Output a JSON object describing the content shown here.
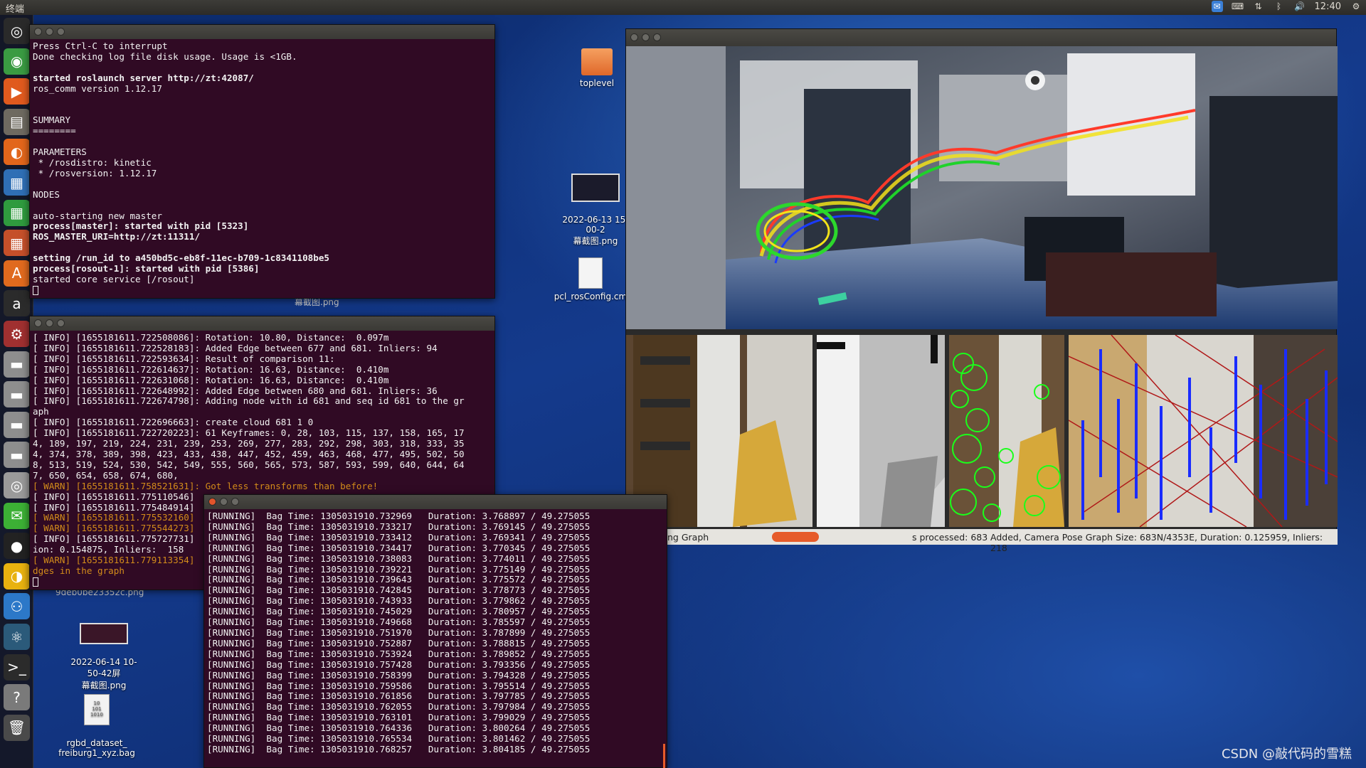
{
  "topbar": {
    "title": "终端",
    "time": "12:40"
  },
  "launcher": {
    "items": [
      {
        "name": "ubuntu-dash-icon",
        "glyph": "◎",
        "color": "#2a2a2a"
      },
      {
        "name": "chrome-icon",
        "glyph": "◉",
        "color": "#3a9b42"
      },
      {
        "name": "video-player-icon",
        "glyph": "▶",
        "color": "#e05a1e"
      },
      {
        "name": "files-icon",
        "glyph": "▤",
        "color": "#6e6a60"
      },
      {
        "name": "firefox-icon",
        "glyph": "◐",
        "color": "#e2661b"
      },
      {
        "name": "writer-icon",
        "glyph": "▦",
        "color": "#2f6fb5"
      },
      {
        "name": "calc-icon",
        "glyph": "▦",
        "color": "#2f9b3e"
      },
      {
        "name": "impress-icon",
        "glyph": "▦",
        "color": "#c5502a"
      },
      {
        "name": "software-center-icon",
        "glyph": "A",
        "color": "#e06a1e"
      },
      {
        "name": "amazon-icon",
        "glyph": "a",
        "color": "#2b2b2b"
      },
      {
        "name": "system-settings-icon",
        "glyph": "⚙",
        "color": "#a03030"
      },
      {
        "name": "drive-icon",
        "glyph": "▬",
        "color": "#8e8e8e"
      },
      {
        "name": "drive-icon",
        "glyph": "▬",
        "color": "#8e8e8e"
      },
      {
        "name": "drive-icon",
        "glyph": "▬",
        "color": "#8e8e8e"
      },
      {
        "name": "drive-icon",
        "glyph": "▬",
        "color": "#8e8e8e"
      },
      {
        "name": "disc-icon",
        "glyph": "◎",
        "color": "#9a9a9a"
      },
      {
        "name": "wechat-icon",
        "glyph": "✉",
        "color": "#3cb035"
      },
      {
        "name": "qq-icon",
        "glyph": "●",
        "color": "#222"
      },
      {
        "name": "app-icon",
        "glyph": "◑",
        "color": "#e8b20f"
      },
      {
        "name": "network-icon",
        "glyph": "⚇",
        "color": "#2c78c8"
      },
      {
        "name": "ros-icon",
        "glyph": "⚛",
        "color": "#2b5a7a"
      },
      {
        "name": "terminal-icon",
        "glyph": ">_",
        "color": "#2b2b2b"
      },
      {
        "name": "help-icon",
        "glyph": "?",
        "color": "#7a7a7a"
      },
      {
        "name": "trash-icon",
        "glyph": "🗑",
        "color": "#4a4a4a"
      }
    ]
  },
  "desktop": {
    "icons": [
      {
        "name": "desktop-folder-toplevel",
        "label": "toplevel"
      },
      {
        "name": "desktop-screenshot-0613",
        "label": "2022-06-13 15-00-2\n幕截图.png"
      },
      {
        "name": "desktop-pcl-config",
        "label": "pcl_rosConfig.cm"
      },
      {
        "name": "desktop-screenshot-0614",
        "label": "2022-06-14 10-50-42屏\n幕截图.png"
      },
      {
        "name": "desktop-bag-file",
        "label": "rgbd_dataset_\nfreiburg1_xyz.bag"
      }
    ],
    "hidden_labels": [
      "幕截图.png",
      "9deb0be23352c.png"
    ]
  },
  "term1": {
    "lines": [
      {
        "t": "Press Ctrl-C to interrupt"
      },
      {
        "t": "Done checking log file disk usage. Usage is <1GB."
      },
      {
        "t": ""
      },
      {
        "t": "started roslaunch server http://zt:42087/",
        "b": true
      },
      {
        "t": "ros_comm version 1.12.17"
      },
      {
        "t": ""
      },
      {
        "t": ""
      },
      {
        "t": "SUMMARY"
      },
      {
        "t": "========"
      },
      {
        "t": ""
      },
      {
        "t": "PARAMETERS"
      },
      {
        "t": " * /rosdistro: kinetic"
      },
      {
        "t": " * /rosversion: 1.12.17"
      },
      {
        "t": ""
      },
      {
        "t": "NODES"
      },
      {
        "t": ""
      },
      {
        "t": "auto-starting new master"
      },
      {
        "t": "process[master]: started with pid [5323]",
        "b": true
      },
      {
        "t": "ROS_MASTER_URI=http://zt:11311/",
        "b": true
      },
      {
        "t": ""
      },
      {
        "t": "setting /run_id to a450bd5c-eb8f-11ec-b709-1c8341108be5",
        "b": true
      },
      {
        "t": "process[rosout-1]: started with pid [5386]",
        "b": true
      },
      {
        "t": "started core service [/rosout]"
      }
    ]
  },
  "term2": {
    "lines": [
      {
        "t": "[ INFO] [1655181611.722508086]: Rotation: 10.80, Distance:  0.097m"
      },
      {
        "t": "[ INFO] [1655181611.722528183]: Added Edge between 677 and 681. Inliers: 94"
      },
      {
        "t": "[ INFO] [1655181611.722593634]: Result of comparison 11:"
      },
      {
        "t": "[ INFO] [1655181611.722614637]: Rotation: 16.63, Distance:  0.410m"
      },
      {
        "t": "[ INFO] [1655181611.722631068]: Rotation: 16.63, Distance:  0.410m"
      },
      {
        "t": "[ INFO] [1655181611.722648992]: Added Edge between 680 and 681. Inliers: 36"
      },
      {
        "t": "[ INFO] [1655181611.722674798]: Adding node with id 681 and seq id 681 to the gr"
      },
      {
        "t": "aph"
      },
      {
        "t": "[ INFO] [1655181611.722696663]: create cloud 681 1 0"
      },
      {
        "t": "[ INFO] [1655181611.722720223]: 61 Keyframes: 0, 28, 103, 115, 137, 158, 165, 17"
      },
      {
        "t": "4, 189, 197, 219, 224, 231, 239, 253, 269, 277, 283, 292, 298, 303, 318, 333, 35"
      },
      {
        "t": "4, 374, 378, 389, 398, 423, 433, 438, 447, 452, 459, 463, 468, 477, 495, 502, 50"
      },
      {
        "t": "8, 513, 519, 524, 530, 542, 549, 555, 560, 565, 573, 587, 593, 599, 640, 644, 64"
      },
      {
        "t": "7, 650, 654, 658, 674, 680,"
      },
      {
        "t": "[ WARN] [1655181611.758521631]: Got less transforms than before!",
        "w": true
      },
      {
        "t": "[ INFO] [1655181611.775110546]"
      },
      {
        "t": "[ INFO] [1655181611.775484914]"
      },
      {
        "t": "[ WARN] [1655181611.775532160]",
        "w": true
      },
      {
        "t": "[ WARN] [1655181611.775544273]",
        "w": true
      },
      {
        "t": "[ INFO] [1655181611.775727731]"
      },
      {
        "t": "ion: 0.154875, Inliers:  158"
      },
      {
        "t": "[ WARN] [1655181611.779113354]",
        "w": true
      },
      {
        "t": "dges in the graph",
        "w": true
      }
    ]
  },
  "term3": {
    "lines": [
      "[RUNNING]  Bag Time: 1305031910.732969   Duration: 3.768897 / 49.275055",
      "[RUNNING]  Bag Time: 1305031910.733217   Duration: 3.769145 / 49.275055",
      "[RUNNING]  Bag Time: 1305031910.733412   Duration: 3.769341 / 49.275055",
      "[RUNNING]  Bag Time: 1305031910.734417   Duration: 3.770345 / 49.275055",
      "[RUNNING]  Bag Time: 1305031910.738083   Duration: 3.774011 / 49.275055",
      "[RUNNING]  Bag Time: 1305031910.739221   Duration: 3.775149 / 49.275055",
      "[RUNNING]  Bag Time: 1305031910.739643   Duration: 3.775572 / 49.275055",
      "[RUNNING]  Bag Time: 1305031910.742845   Duration: 3.778773 / 49.275055",
      "[RUNNING]  Bag Time: 1305031910.743933   Duration: 3.779862 / 49.275055",
      "[RUNNING]  Bag Time: 1305031910.745029   Duration: 3.780957 / 49.275055",
      "[RUNNING]  Bag Time: 1305031910.749668   Duration: 3.785597 / 49.275055",
      "[RUNNING]  Bag Time: 1305031910.751970   Duration: 3.787899 / 49.275055",
      "[RUNNING]  Bag Time: 1305031910.752887   Duration: 3.788815 / 49.275055",
      "[RUNNING]  Bag Time: 1305031910.753924   Duration: 3.789852 / 49.275055",
      "[RUNNING]  Bag Time: 1305031910.757428   Duration: 3.793356 / 49.275055",
      "[RUNNING]  Bag Time: 1305031910.758399   Duration: 3.794328 / 49.275055",
      "[RUNNING]  Bag Time: 1305031910.759586   Duration: 3.795514 / 49.275055",
      "[RUNNING]  Bag Time: 1305031910.761856   Duration: 3.797785 / 49.275055",
      "[RUNNING]  Bag Time: 1305031910.762055   Duration: 3.797984 / 49.275055",
      "[RUNNING]  Bag Time: 1305031910.763101   Duration: 3.799029 / 49.275055",
      "[RUNNING]  Bag Time: 1305031910.764336   Duration: 3.800264 / 49.275055",
      "[RUNNING]  Bag Time: 1305031910.765534   Duration: 3.801462 / 49.275055",
      "[RUNNING]  Bag Time: 1305031910.768257   Duration: 3.804185 / 49.275055"
    ]
  },
  "viewer": {
    "status_left": "ng Graph",
    "status_mid": "s processed: 683",
    "status_right": "Added, Camera Pose Graph Size: 683N/4353E, Duration: 0.125959, Inliers:  218",
    "accent": "#e65b2a"
  },
  "watermark": "CSDN @敲代码的雪糕"
}
